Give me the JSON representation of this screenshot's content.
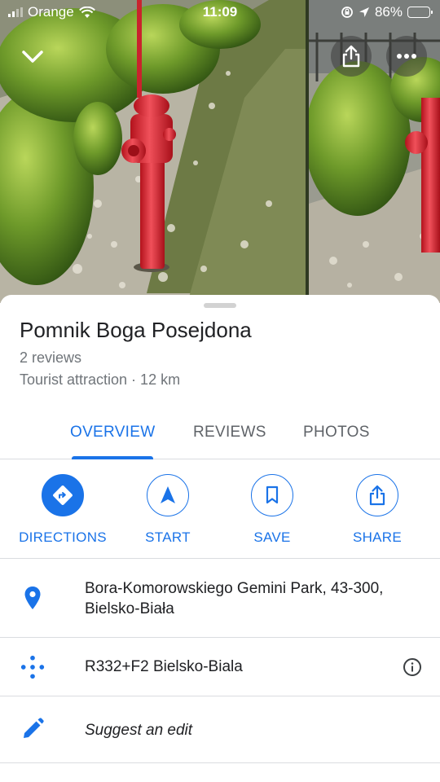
{
  "status_bar": {
    "carrier": "Orange",
    "time": "11:09",
    "battery": "86%",
    "battery_level": 0.86
  },
  "photos": {
    "count_visible": 2
  },
  "place": {
    "name": "Pomnik Boga Posejdona",
    "reviews": "2 reviews",
    "category": "Tourist attraction · 12 km"
  },
  "tabs": [
    {
      "label": "OVERVIEW",
      "active": true
    },
    {
      "label": "REVIEWS",
      "active": false
    },
    {
      "label": "PHOTOS",
      "active": false
    }
  ],
  "actions": [
    {
      "label": "DIRECTIONS",
      "icon": "directions-icon"
    },
    {
      "label": "START",
      "icon": "navigation-arrow-icon"
    },
    {
      "label": "SAVE",
      "icon": "bookmark-icon"
    },
    {
      "label": "SHARE",
      "icon": "share-icon"
    }
  ],
  "details": {
    "address_line1": "Bora-Komorowskiego Gemini Park, 43-300,",
    "address_line2": "Bielsko-Biała",
    "plus_code": "R332+F2 Bielsko-Biala",
    "suggest_edit": "Suggest an edit"
  },
  "colors": {
    "accent": "#1a73e8",
    "text_primary": "#202124",
    "text_secondary": "#70757a",
    "divider": "#dadce0"
  }
}
